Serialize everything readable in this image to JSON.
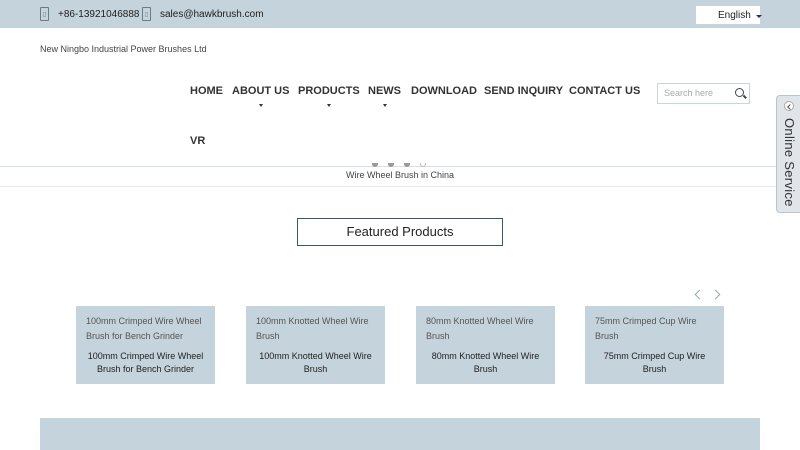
{
  "topbar": {
    "phone": "+86-13921046888",
    "email": "sales@hawkbrush.com",
    "language": "English"
  },
  "header": {
    "company": "New Ningbo Industrial Power Brushes Ltd",
    "search_placeholder": "Search here"
  },
  "nav": {
    "items": [
      {
        "label": "HOME"
      },
      {
        "label": "ABOUT US"
      },
      {
        "label": "PRODUCTS"
      },
      {
        "label": "NEWS"
      },
      {
        "label": "DOWNLOAD"
      },
      {
        "label": "SEND INQUIRY"
      },
      {
        "label": "CONTACT US"
      },
      {
        "label": "VR"
      }
    ]
  },
  "banner": {
    "caption": "Wire Wheel Brush in China"
  },
  "featured": {
    "title": "Featured Products",
    "products": [
      {
        "image_alt": "100mm Crimped Wire Wheel Brush for Bench Grinder",
        "name": "100mm Crimped Wire Wheel Brush for Bench Grinder"
      },
      {
        "image_alt": "100mm Knotted Wheel Wire Brush",
        "name": "100mm Knotted Wheel Wire Brush"
      },
      {
        "image_alt": "80mm Knotted Wheel Wire Brush",
        "name": "80mm Knotted Wheel Wire Brush"
      },
      {
        "image_alt": "75mm Crimped Cup Wire Brush",
        "name": "75mm Crimped Cup Wire Brush"
      }
    ]
  },
  "sidebar": {
    "online_service": "Online Service"
  },
  "colors": {
    "band": "#c5d3dc",
    "featured_border": "#3b5463"
  }
}
